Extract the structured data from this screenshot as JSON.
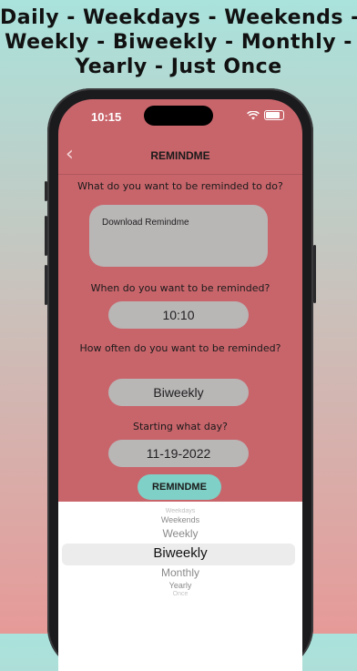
{
  "banner": {
    "line1": "Daily - Weekdays - Weekends -",
    "line2": "Weekly - Biweekly - Monthly -",
    "line3": "Yearly - Just Once"
  },
  "status_bar": {
    "time": "10:15"
  },
  "nav": {
    "back_icon": "chevron-left",
    "title": "REMINDME"
  },
  "form": {
    "q1": "What do you want to be reminded to do?",
    "reminder_text": "Download Remindme",
    "q2": "When do you want to be reminded?",
    "time_value": "10:10",
    "q3": "How often do you want to be reminded?",
    "frequency_value": "Biweekly",
    "q4": "Starting what day?",
    "date_value": "11-19-2022",
    "submit_label": "REMINDME"
  },
  "picker": {
    "options": [
      "Weekdays",
      "Weekends",
      "Weekly",
      "Biweekly",
      "Monthly",
      "Yearly",
      "Once"
    ],
    "selected": "Biweekly"
  },
  "colors": {
    "screen_bg": "#c8656b",
    "button_teal": "#7fd0c6",
    "field_gray": "#b9b6b6"
  }
}
